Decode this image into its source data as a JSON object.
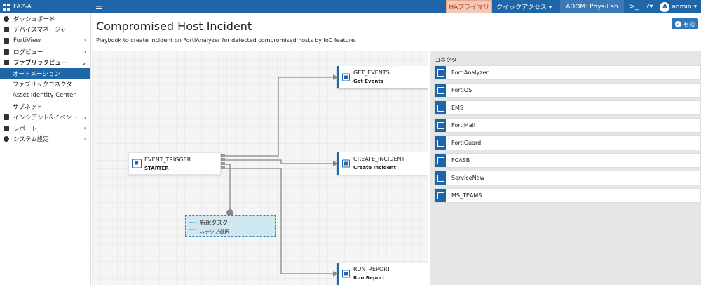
{
  "topbar": {
    "app_name": "FAZ-A",
    "ha_badge": "HAプライマリ",
    "quick_access": "クイックアクセス ▾",
    "adom": "ADOM: Phys-Lab",
    "avatar_letter": "A",
    "user": "admin ▾"
  },
  "sidebar": {
    "items": [
      {
        "label": "ダッシュボード"
      },
      {
        "label": "デバイスマネージャ"
      },
      {
        "label": "FortiView"
      },
      {
        "label": "ログビュー"
      },
      {
        "label": "ファブリックビュー"
      },
      {
        "label": "オートメーション"
      },
      {
        "label": "ファブリックコネクタ"
      },
      {
        "label": "Asset Identity Center"
      },
      {
        "label": "サブネット"
      },
      {
        "label": "インシデント&イベント"
      },
      {
        "label": "レポート"
      },
      {
        "label": "システム設定"
      }
    ]
  },
  "main": {
    "title": "Compromised Host Incident",
    "description": "Playbook to create incident on FortiAnalyzer for detected compromised hosts by IoC feature.",
    "enable_label": "有効"
  },
  "canvas": {
    "nodes": {
      "trigger": {
        "title": "EVENT_TRIGGER",
        "sub": "STARTER"
      },
      "get_events": {
        "title": "GET_EVENTS",
        "sub": "Get Events"
      },
      "create_incident": {
        "title": "CREATE_INCIDENT",
        "sub": "Create Incident"
      },
      "new_task": {
        "title": "新規タスク",
        "sub": "ステップ選択"
      },
      "run_report": {
        "title": "RUN_REPORT",
        "sub": "Run Report"
      }
    }
  },
  "connectors": {
    "heading": "コネクタ",
    "items": [
      {
        "label": "FortiAnalyzer"
      },
      {
        "label": "FortiOS"
      },
      {
        "label": "EMS"
      },
      {
        "label": "FortiMail"
      },
      {
        "label": "FortiGuard"
      },
      {
        "label": "FCASB"
      },
      {
        "label": "ServiceNow"
      },
      {
        "label": "MS_TEAMS"
      }
    ]
  },
  "colors": {
    "brand": "#1f66a8",
    "active_nav": "#1f66a8",
    "new_task_fill": "#cfe7ee"
  }
}
